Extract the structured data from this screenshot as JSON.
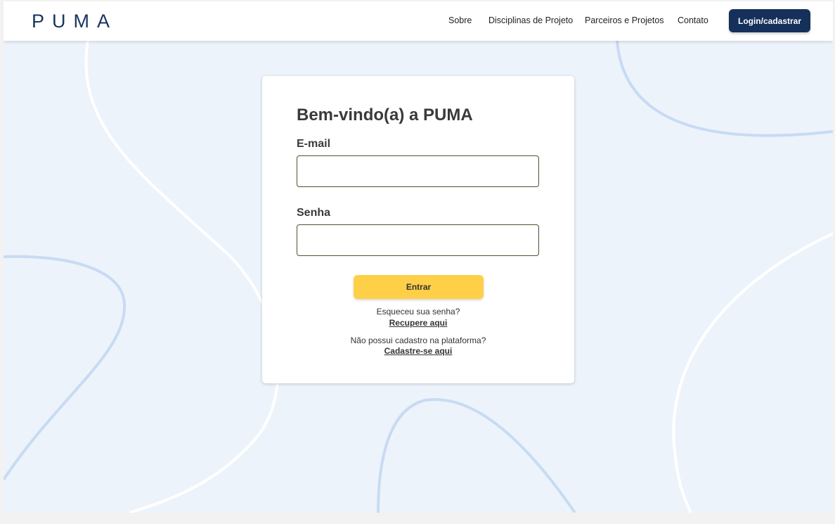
{
  "header": {
    "logo": "PUMA",
    "nav": [
      "Sobre",
      "Disciplinas de Projeto",
      "Parceiros e Projetos",
      "Contato"
    ],
    "login_button": "Login/cadastrar"
  },
  "login_card": {
    "title": "Bem-vindo(a) a PUMA",
    "email_label": "E-mail",
    "email_value": "",
    "password_label": "Senha",
    "password_value": "",
    "submit_label": "Entrar",
    "forgot_text": "Esqueceu sua senha?",
    "forgot_link": "Recupere aqui",
    "register_text": "Não possui cadastro na plataforma?",
    "register_link": "Cadastre-se aqui"
  },
  "colors": {
    "brand_navy": "#15305a",
    "accent_yellow": "#ffcf48",
    "background": "#edf3fb",
    "decor_blue": "#c7dbf3"
  }
}
